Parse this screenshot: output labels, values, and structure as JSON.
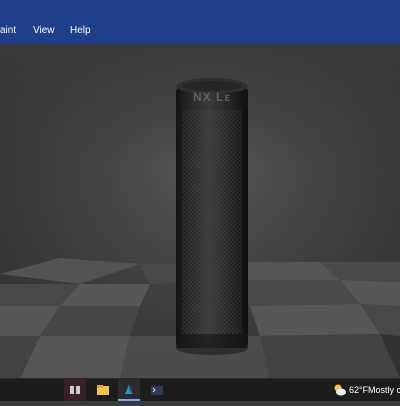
{
  "menubar": {
    "items": [
      {
        "label": "aint"
      },
      {
        "label": "View"
      },
      {
        "label": "Help"
      }
    ]
  },
  "viewport": {
    "model": {
      "engraving_text": "NX Lε"
    }
  },
  "taskbar": {
    "icons": [
      {
        "name": "task-view-icon"
      },
      {
        "name": "file-explorer-icon"
      },
      {
        "name": "paint-3d-icon"
      },
      {
        "name": "terminal-icon"
      }
    ],
    "weather": {
      "temperature": "62°F",
      "condition": "Mostly c",
      "icon": "partly-cloudy-icon"
    }
  },
  "colors": {
    "menubar_bg": "#1f3f8a",
    "taskbar_bg": "#1c1c1c",
    "floor_light": "#5a5a5a",
    "floor_dark": "#464646",
    "cylinder": "#2a2a2a"
  }
}
